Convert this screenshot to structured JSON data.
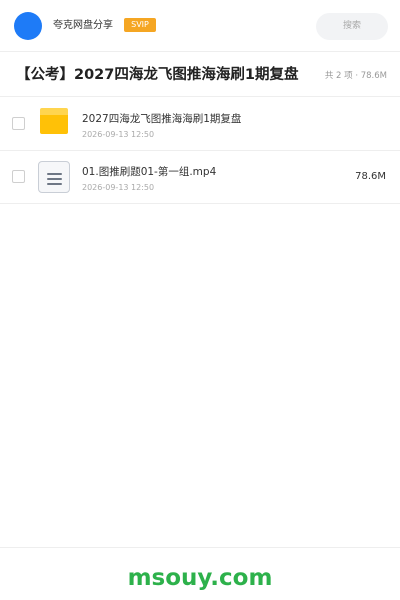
{
  "header": {
    "brand_name": "夸克网盘分享",
    "badge": "SVIP",
    "search_label": "搜索"
  },
  "folder": {
    "title": "【公考】2027四海龙飞图推海海刷1期复盘",
    "summary": "共 2 项 · 78.6M"
  },
  "files": [
    {
      "icon": "folder-icon",
      "name": "2027四海龙飞图推海海刷1期复盘",
      "date": "2026-09-13 12:50",
      "size": ""
    },
    {
      "icon": "video-file-icon",
      "name": "01.图推刷题01-第一组.mp4",
      "date": "2026-09-13 12:50",
      "size": "78.6M"
    }
  ],
  "footer": {
    "watermark": "msouy.com"
  },
  "colors": {
    "brand_blue": "#1e7bf7",
    "svip_orange": "#f5a623",
    "folder_yellow": "#ffc107",
    "watermark_green": "#2db14b"
  }
}
